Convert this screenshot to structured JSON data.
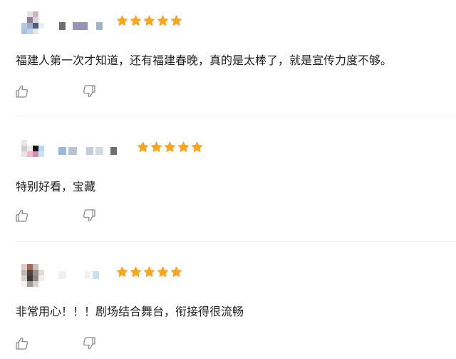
{
  "reviews": [
    {
      "content": "福建人第一次才知道，还有福建春晚，真的是太棒了，就是宣传力度不够。",
      "rating": 5,
      "avatar": "blurred-avatar",
      "username_obscured": true
    },
    {
      "content": "特别好看，宝藏",
      "rating": 5,
      "avatar": "blurred-avatar",
      "username_obscured": true
    },
    {
      "content": "非常用心！！！剧场结合舞台，衔接得很流畅",
      "rating": 5,
      "avatar": "blurred-avatar",
      "username_obscured": true
    }
  ],
  "colors": {
    "star": "#f5a623",
    "icon": "#8a8a8a",
    "divider": "#efefef",
    "text": "#1f1f1f"
  },
  "icons": {
    "like": "thumbs-up-icon",
    "dislike": "thumbs-down-icon",
    "star": "star-icon"
  }
}
